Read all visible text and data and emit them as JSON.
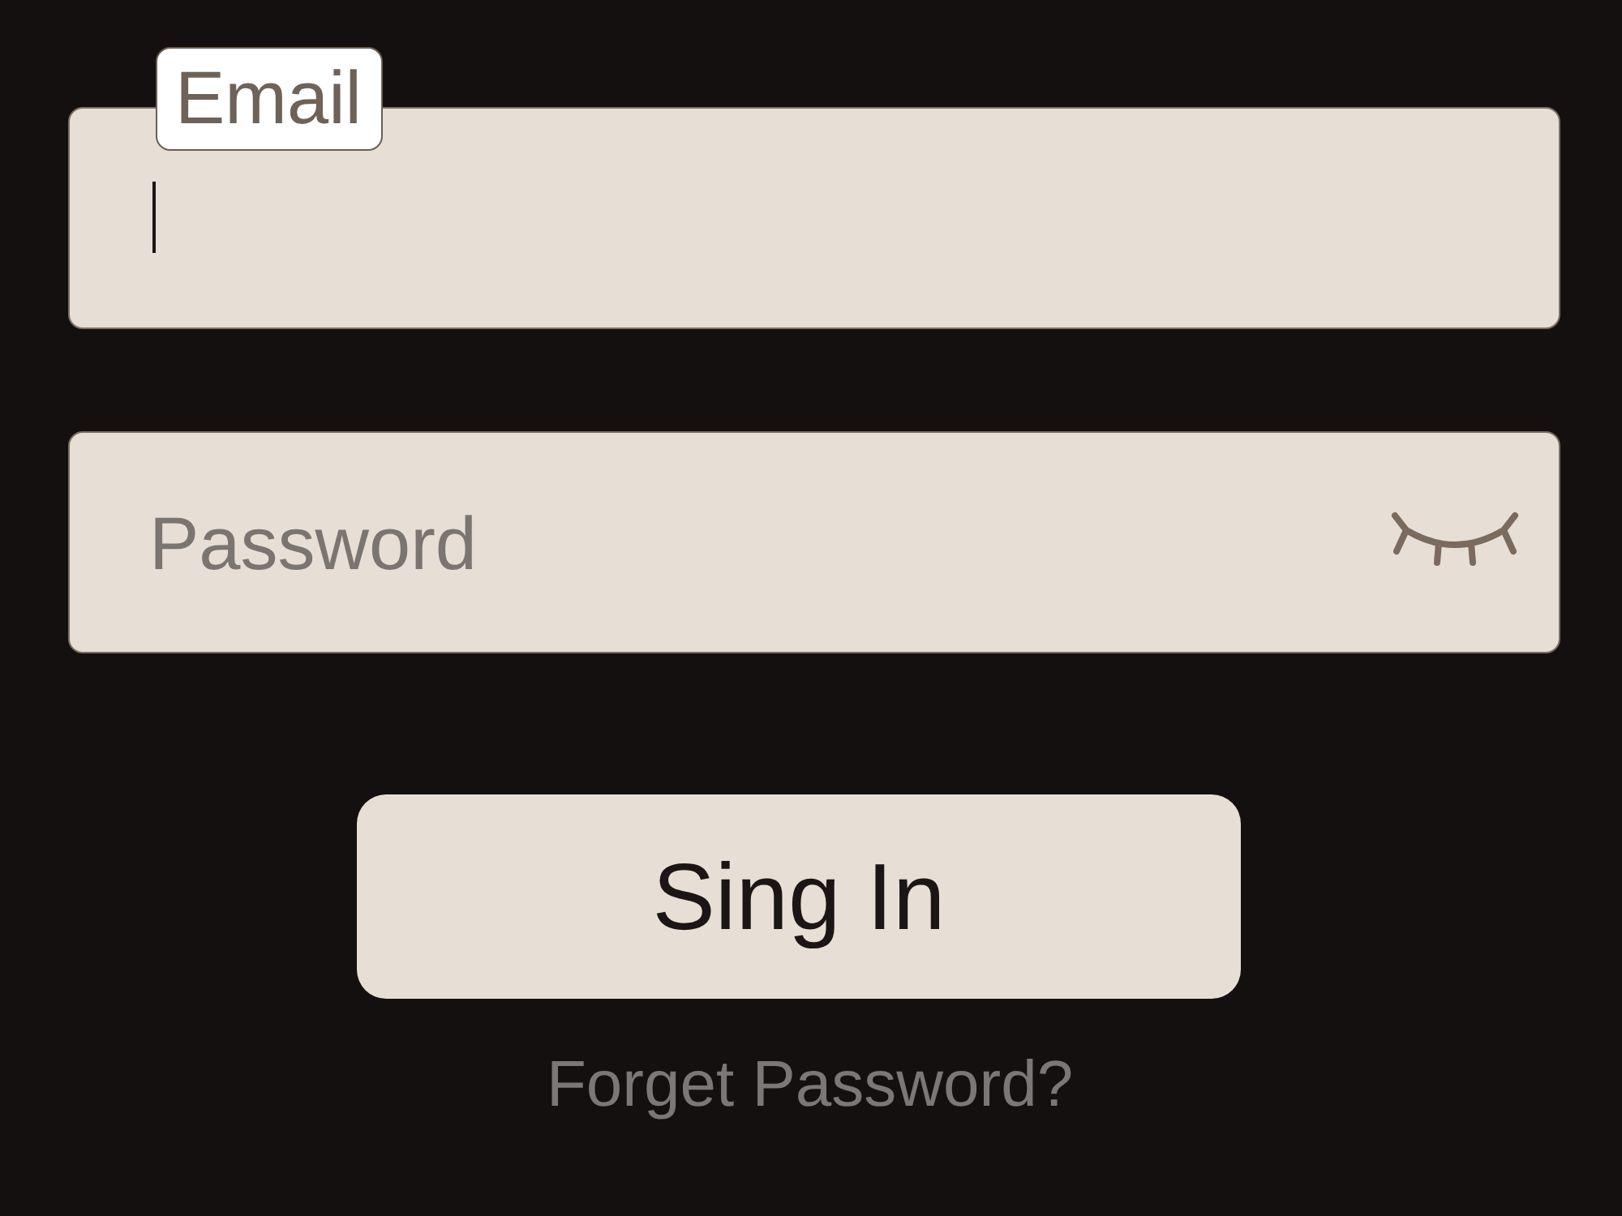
{
  "fields": [
    {
      "kind": "text",
      "label": "Email",
      "focused": true
    },
    {
      "kind": "password",
      "placeholder": "Password",
      "focused": false,
      "revealed": false
    }
  ],
  "submit_button": {
    "label": "Sing In"
  },
  "forgot_link": {
    "label": "Forget Password?"
  }
}
